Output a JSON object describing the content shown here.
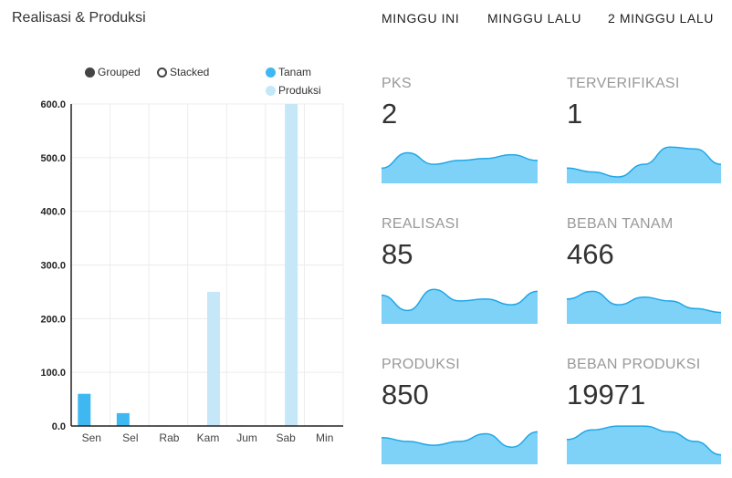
{
  "header": {
    "title": "Realisasi & Produksi",
    "tabs": [
      "MINGGU INI",
      "MINGGU LALU",
      "2 MINGGU LALU"
    ]
  },
  "legend": {
    "modes": [
      "Grouped",
      "Stacked"
    ],
    "selected_mode": "Grouped"
  },
  "chart_data": {
    "type": "bar",
    "categories": [
      "Sen",
      "Sel",
      "Rab",
      "Kam",
      "Jum",
      "Sab",
      "Min"
    ],
    "series": [
      {
        "name": "Tanam",
        "color": "#3fb8f2",
        "values": [
          60,
          24,
          1,
          1,
          1,
          1,
          1
        ]
      },
      {
        "name": "Produksi",
        "color": "#c5e7f8",
        "values": [
          0,
          0,
          0,
          250,
          0,
          600,
          0
        ]
      }
    ],
    "yticks": [
      "0.0",
      "100.0",
      "200.0",
      "300.0",
      "400.0",
      "500.0",
      "600.0"
    ],
    "ylim": [
      0,
      600
    ],
    "grid": true,
    "legend_position": "top-right"
  },
  "cards": [
    {
      "label": "PKS",
      "value": "2",
      "trend": [
        0.35,
        0.75,
        0.45,
        0.55,
        0.6,
        0.7,
        0.55
      ]
    },
    {
      "label": "TERVERIFIKASI",
      "value": "1",
      "trend": [
        0.35,
        0.25,
        0.12,
        0.45,
        0.9,
        0.85,
        0.45
      ]
    },
    {
      "label": "REALISASI",
      "value": "85",
      "trend": [
        0.7,
        0.3,
        0.85,
        0.55,
        0.6,
        0.45,
        0.8
      ]
    },
    {
      "label": "BEBAN TANAM",
      "value": "466",
      "trend": [
        0.6,
        0.8,
        0.45,
        0.65,
        0.55,
        0.35,
        0.25
      ]
    },
    {
      "label": "PRODUKSI",
      "value": "850",
      "trend": [
        0.65,
        0.55,
        0.45,
        0.55,
        0.75,
        0.4,
        0.8
      ]
    },
    {
      "label": "BEBAN PRODUKSI",
      "value": "19971",
      "trend": [
        0.6,
        0.85,
        0.95,
        0.95,
        0.8,
        0.55,
        0.2
      ]
    }
  ],
  "colors": {
    "bar_primary": "#3fb8f2",
    "bar_secondary": "#c5e7f8",
    "spark_fill": "#7fd2f7",
    "spark_stroke": "#1fa7e8",
    "grid": "#ececec"
  }
}
